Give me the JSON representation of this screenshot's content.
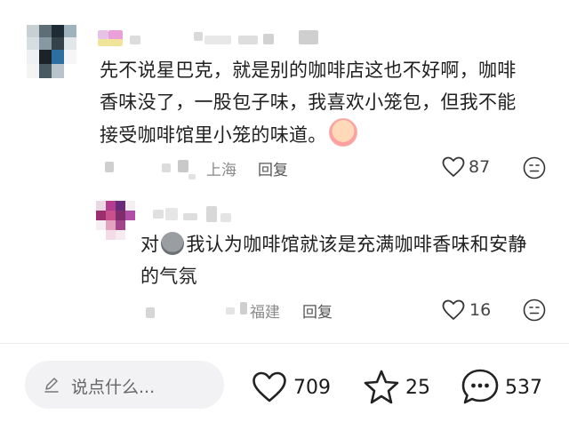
{
  "comment1": {
    "text": "先不说星巴克，就是别的咖啡店这也不好啊，咖啡香味没了，一股包子味，我喜欢小笼包，但我不能接受咖啡馆里小笼的味道。",
    "line1": "先不说星巴克，就是别的咖啡店这也不好啊，咖啡",
    "line2": "香味没了，一股包子味，我喜欢小笼包，但我不能",
    "line3": "接受咖啡馆里小笼的味道。",
    "location": "上海",
    "reply_label": "回复",
    "likes": "87",
    "emoji_icon": "crying-face-emoji"
  },
  "comment2": {
    "text_prefix": "对",
    "text_rest": "我认为咖啡馆就该是充满咖啡香味和安静",
    "line2": "的气氛",
    "location": "福建",
    "reply_label": "回复",
    "likes": "16",
    "emoji_icon": "grimace-face-emoji"
  },
  "bottom_bar": {
    "input_placeholder": "说点什么...",
    "likes": "709",
    "favorites": "25",
    "comments": "537"
  },
  "colors": {
    "meta_gray": "#8a8a8a",
    "input_bg": "#f2f2f4"
  }
}
